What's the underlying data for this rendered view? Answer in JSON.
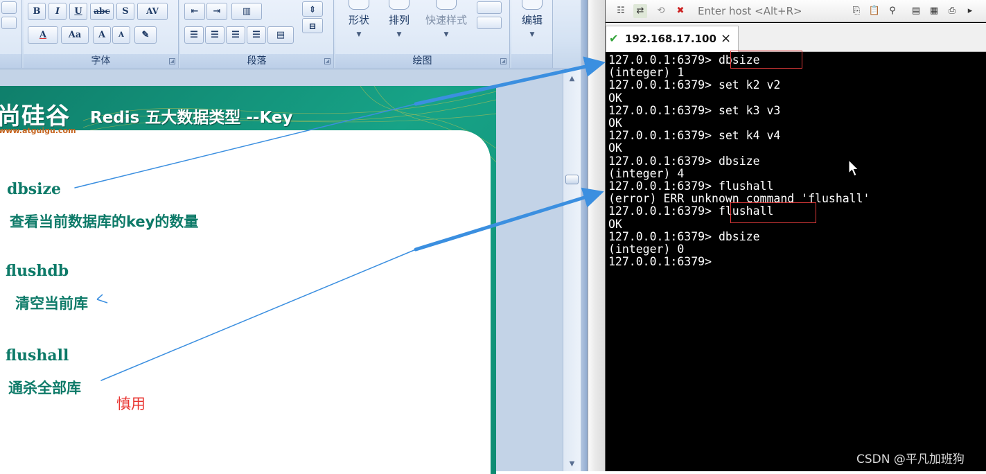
{
  "ppt": {
    "font_group_title": "字体",
    "paragraph_group_title": "段落",
    "drawing_group_title": "绘图",
    "font_buttons": [
      "B",
      "I",
      "U",
      "abc",
      "S",
      "AV"
    ],
    "font_buttons_row2": [
      "A",
      "Aa",
      "A",
      "A"
    ],
    "drawing_buttons": [
      "形状",
      "排列",
      "快速样式"
    ],
    "edit_button": "编辑"
  },
  "slide": {
    "logo_text": "尚硅谷",
    "logo_url": "www.atguigu.com",
    "title": "Redis 五大数据类型 --Key",
    "items": [
      {
        "term": "dbsize",
        "desc": "查看当前数据库的key的数量"
      },
      {
        "term": "flushdb",
        "desc": "清空当前库"
      },
      {
        "term": "flushall",
        "desc": "通杀全部库"
      }
    ],
    "caution": "慎用"
  },
  "xshell": {
    "host_placeholder": "Enter host <Alt+R>",
    "tab_label": "192.168.17.100",
    "tab_close": "×",
    "terminal_lines": [
      "127.0.0.1:6379> dbsize",
      "(integer) 1",
      "127.0.0.1:6379> set k2 v2",
      "OK",
      "127.0.0.1:6379> set k3 v3",
      "OK",
      "127.0.0.1:6379> set k4 v4",
      "OK",
      "127.0.0.1:6379> dbsize",
      "(integer) 4",
      "127.0.0.1:6379> flushall",
      "(error) ERR unknown command 'flushall'",
      "127.0.0.1:6379> flushall",
      "OK",
      "127.0.0.1:6379> dbsize",
      "(integer) 0",
      "127.0.0.1:6379>"
    ]
  },
  "watermark": "CSDN @平凡加班狗",
  "colors": {
    "slide_green": "#0d7a68",
    "caution_red": "#e8332f",
    "arrow_blue": "#3b8fe0",
    "highlight_red": "#e03a3a"
  }
}
